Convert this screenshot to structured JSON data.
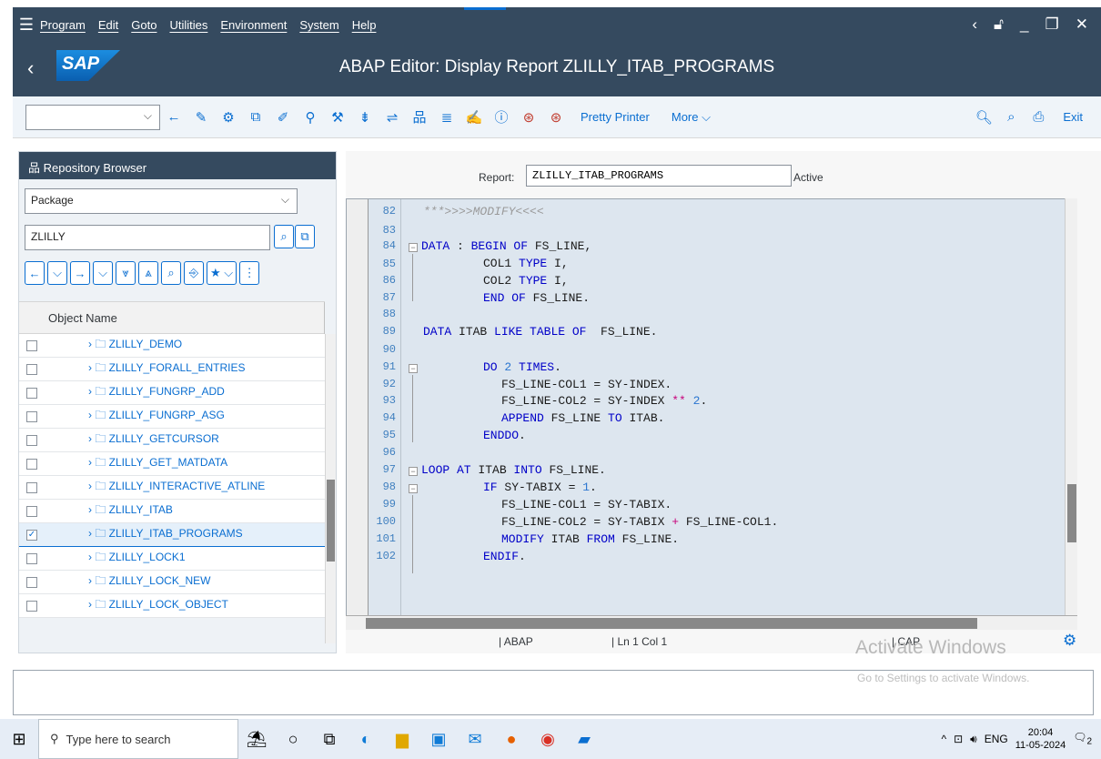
{
  "menu": {
    "items": [
      "Program",
      "Edit",
      "Goto",
      "Utilities",
      "Environment",
      "System",
      "Help"
    ],
    "right_icons": [
      "back-chevron-icon",
      "lock-icon",
      "minimize-icon",
      "maximize-icon",
      "close-icon"
    ]
  },
  "titlebar": {
    "logo": "SAP",
    "title": "ABAP Editor: Display Report ZLILLY_ITAB_PROGRAMS"
  },
  "toolbar": {
    "command_field": "",
    "pretty_printer": "Pretty Printer",
    "more": "More",
    "exit": "Exit"
  },
  "repository_browser": {
    "title": "Repository Browser",
    "type_select": "Package",
    "name_input": "ZLILLY",
    "column_header": "Object Name",
    "items": [
      {
        "label": "ZLILLY_DEMO",
        "checked": false
      },
      {
        "label": "ZLILLY_FORALL_ENTRIES",
        "checked": false
      },
      {
        "label": "ZLILLY_FUNGRP_ADD",
        "checked": false
      },
      {
        "label": "ZLILLY_FUNGRP_ASG",
        "checked": false
      },
      {
        "label": "ZLILLY_GETCURSOR",
        "checked": false
      },
      {
        "label": "ZLILLY_GET_MATDATA",
        "checked": false
      },
      {
        "label": "ZLILLY_INTERACTIVE_ATLINE",
        "checked": false
      },
      {
        "label": "ZLILLY_ITAB",
        "checked": false
      },
      {
        "label": "ZLILLY_ITAB_PROGRAMS",
        "checked": true
      },
      {
        "label": "ZLILLY_LOCK1",
        "checked": false
      },
      {
        "label": "ZLILLY_LOCK_NEW",
        "checked": false
      },
      {
        "label": "ZLILLY_LOCK_OBJECT",
        "checked": false
      }
    ]
  },
  "report": {
    "label": "Report:",
    "value": "ZLILLY_ITAB_PROGRAMS",
    "status": "Active"
  },
  "editor": {
    "line_numbers": [
      "82",
      "83",
      "84",
      "85",
      "86",
      "87",
      "88",
      "89",
      "90",
      "91",
      "92",
      "93",
      "94",
      "95",
      "96",
      "97",
      "98",
      "99",
      "100",
      "101",
      "102"
    ]
  },
  "statusbar": {
    "language": "| ABAP",
    "position": "| Ln  1 Col  1",
    "caps": "| CAP"
  },
  "watermark": {
    "title": "Activate Windows",
    "subtitle": "Go to Settings to activate Windows."
  },
  "taskbar": {
    "search_placeholder": "Type here to search",
    "lang": "ENG",
    "time": "20:04",
    "date": "11-05-2024",
    "notif_count": "2"
  }
}
